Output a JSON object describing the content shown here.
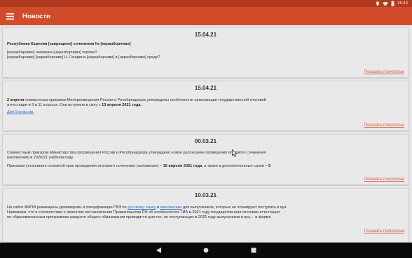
{
  "status_bar": {
    "time": "16:43"
  },
  "app_bar": {
    "title": "Новости"
  },
  "news": [
    {
      "date": "15.04.21",
      "headline": "Республика Карелия [запрещено] сочинения № [неразборчиво]",
      "lines": [
        "[неразборчиво] человека [неразборчиво] героем?",
        "[неразборчиво] [неразборчиво] Н. Гагарина [неразборчиво] в [неразборчиво] среде?"
      ],
      "more": "Показать полностью"
    },
    {
      "date": "15.04.21",
      "lines_prefix": "2 апреля",
      "lines": [
        "совместным приказом Минпросвещения России и Рособрнадзора утверждены особенности организации государственной итоговой",
        "аттестации в 9 и 11 классах. Они вступили в силу с"
      ],
      "emphasis": "13 апреля 2021 года.",
      "link_text": "Для 9 классов.",
      "more": "Показать полностью"
    },
    {
      "date": "00.03.21",
      "lines": [
        "Совместным приказом Министерства просвещения России и Рособрнадзора утверждено новое расписание проведения итогового сочинения",
        "(изложения) в 2020/21 учебном году.",
        "Приказом установлен основной срок проведения итогового сочинения (изложения) –"
      ],
      "emphasis": "15 апреля 2021 года",
      "tail": ", а также в дополнительные сроки –",
      "tail_num": "5",
      "more": "Показать полностью"
    },
    {
      "date": "10.03.21",
      "lines": [
        "На сайте ФИПИ размещены демоверсии и спецификации ГВЭ по",
        "для выпускников, которые не планируют поступать в вуз.",
        "Напомним, что в соответствии с проектом постановления Правительства РФ об особенностях ГИА в 2021 году государственная итоговая аттестация",
        "по образовательным программам среднего общего образования проводится для тех, не поступающих в 2021 году выпускников в вуз, – в форме"
      ],
      "links": [
        "русскому языку",
        "математике"
      ],
      "more": "Показать полностью"
    }
  ],
  "colors": {
    "status_bar": "#b03a1e",
    "app_bar": "#d24c2b",
    "more_link": "#d65a3a",
    "link": "#2b6fd0",
    "nav_bar": "#0a0a0a"
  }
}
